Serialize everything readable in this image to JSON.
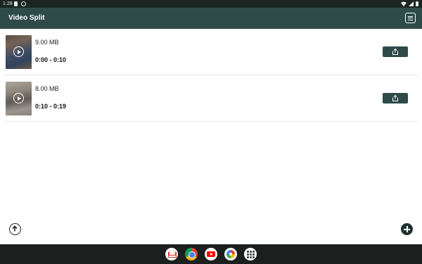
{
  "status_bar": {
    "time": "1:28"
  },
  "app_bar": {
    "title": "Video Split"
  },
  "clips": [
    {
      "size": "9.00 MB",
      "range": "0:00 - 0:10"
    },
    {
      "size": "8.00 MB",
      "range": "0:10 - 0:19"
    }
  ],
  "icons": {
    "menu": "list-menu-icon",
    "play": "play-icon",
    "share": "share-icon",
    "upload": "upload-icon",
    "add": "add-icon"
  },
  "dock": [
    "Gmail",
    "Chrome",
    "YouTube",
    "Photos",
    "App drawer"
  ],
  "colors": {
    "primary": "#2e4b48",
    "dark": "#1f2f2d"
  }
}
